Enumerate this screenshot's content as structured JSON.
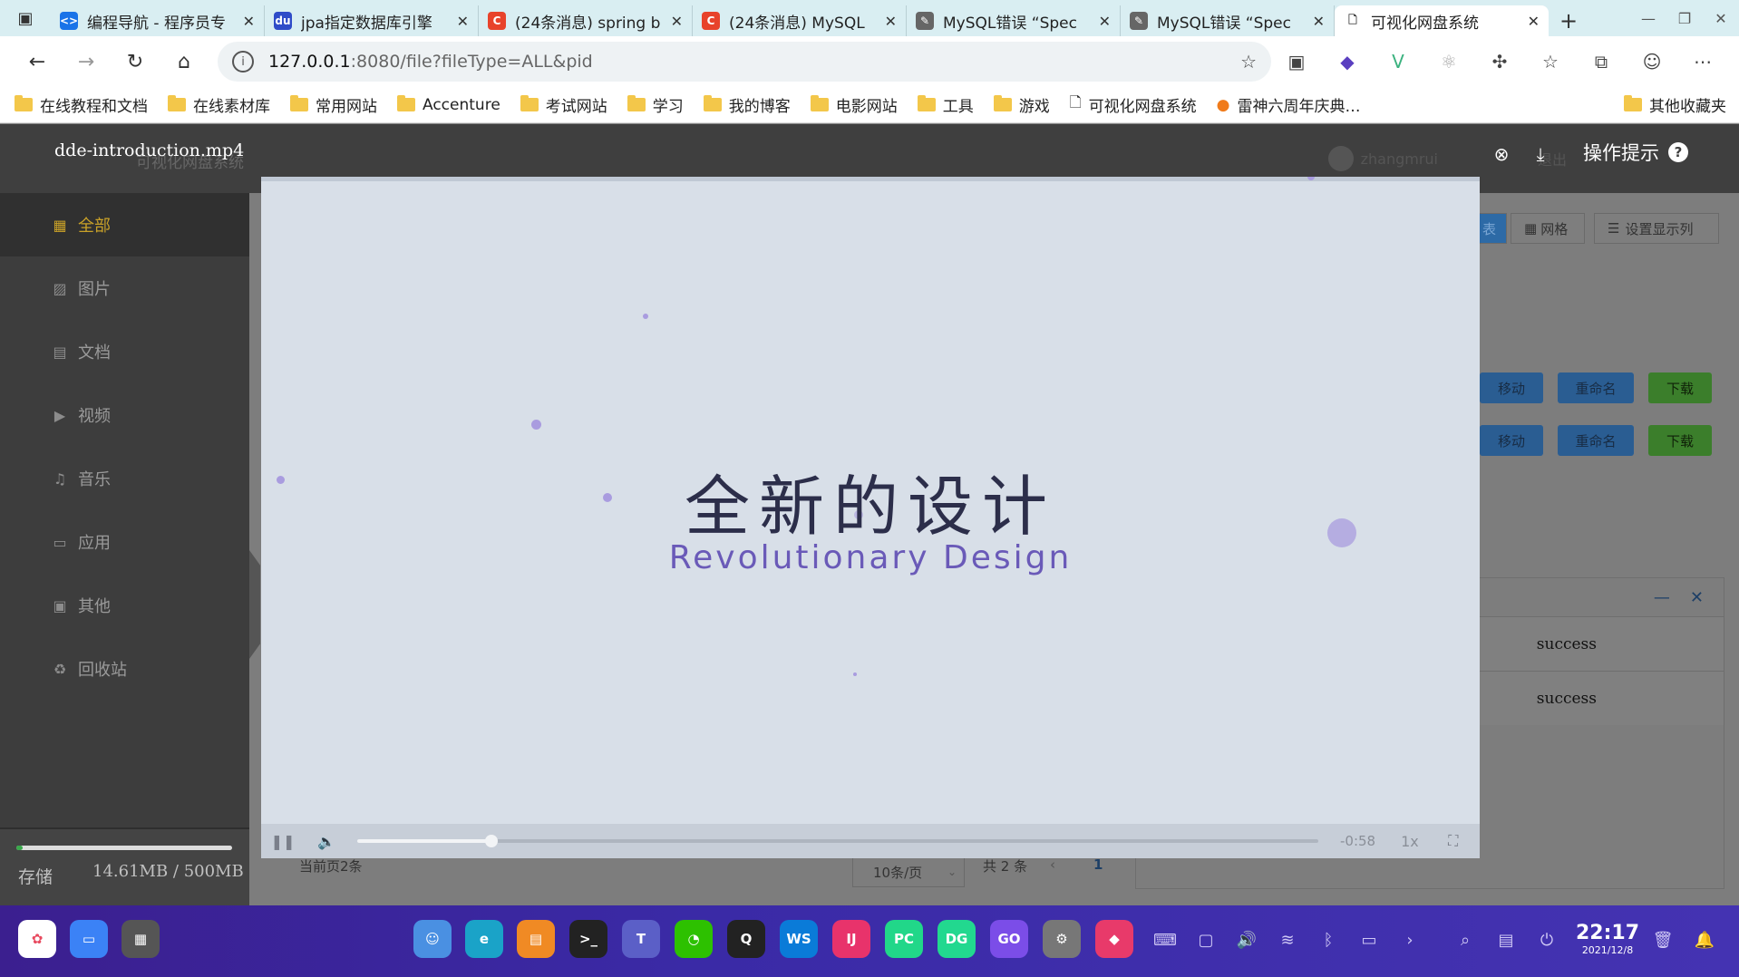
{
  "browser": {
    "tabs": [
      {
        "title": "编程导航 - 程序员专",
        "icon_color": "#1a73e8",
        "icon_text": "<>"
      },
      {
        "title": "jpa指定数据库引擎",
        "icon_color": "#2f4cc8",
        "icon_text": "du"
      },
      {
        "title": "(24条消息) spring b",
        "icon_color": "#e8432b",
        "icon_text": "C"
      },
      {
        "title": "(24条消息) MySQL",
        "icon_color": "#e8432b",
        "icon_text": "C"
      },
      {
        "title": "MySQL错误 “Spec",
        "icon_color": "#666666",
        "icon_text": "✎"
      },
      {
        "title": "MySQL错误 “Spec",
        "icon_color": "#666666",
        "icon_text": "✎"
      },
      {
        "title": "可视化网盘系统",
        "icon_color": "#ffffff",
        "icon_text": "🗋",
        "active": true
      }
    ],
    "url_host": "127.0.0.1",
    "url_rest": ":8080/file?fileType=ALL&pid",
    "bookmarks": [
      "在线教程和文档",
      "在线素材库",
      "常用网站",
      "Accenture",
      "考试网站",
      "学习",
      "我的博客",
      "电影网站",
      "工具",
      "游戏",
      "可视化网盘系统",
      "雷神六周年庆典…"
    ],
    "bookmarks_other": "其他收藏夹"
  },
  "app": {
    "playing_file": "dde-introduction.mp4",
    "system_name": "可视化网盘系统",
    "username": "zhangmrui",
    "logout": "退出",
    "tip_label": "操作提示",
    "sidebar": [
      {
        "label": "全部",
        "icon": "grid-icon",
        "glyph": "▦",
        "active": true
      },
      {
        "label": "图片",
        "icon": "image-icon",
        "glyph": "▨"
      },
      {
        "label": "文档",
        "icon": "document-icon",
        "glyph": "▤"
      },
      {
        "label": "视频",
        "icon": "video-icon",
        "glyph": "▶"
      },
      {
        "label": "音乐",
        "icon": "headphones-icon",
        "glyph": "♫"
      },
      {
        "label": "应用",
        "icon": "monitor-icon",
        "glyph": "▭"
      },
      {
        "label": "其他",
        "icon": "box-icon",
        "glyph": "▣"
      },
      {
        "label": "回收站",
        "icon": "trash-icon",
        "glyph": "♻"
      }
    ],
    "storage": {
      "label": "存储",
      "value": "14.61MB / 500MB",
      "used_fraction": 0.029
    },
    "view_buttons": {
      "list": "表",
      "grid": "网格",
      "columns": "设置显示列"
    },
    "row_actions": {
      "move": "移动",
      "rename": "重命名",
      "download": "下载"
    },
    "notifications": [
      "success",
      "success"
    ],
    "pager": {
      "current": "当前页2条",
      "page_size": "10条/页",
      "total": "共 2 条",
      "page": "1"
    }
  },
  "video": {
    "title_cn": "全新的设计",
    "title_en": "Revolutionary Design",
    "remaining": "-0:58",
    "speed": "1x",
    "progress": 0.14
  },
  "taskbar": {
    "time": "22:17",
    "date": "2021/12/8",
    "apps": [
      {
        "name": "launcher-icon",
        "color": "#ffffff",
        "text": "✿"
      },
      {
        "name": "multitask-icon",
        "color": "#3b82f6",
        "text": "▭"
      },
      {
        "name": "workspace-icon",
        "color": "#555555",
        "text": "▦"
      },
      {
        "name": "finder-icon",
        "color": "#4a90e2",
        "text": "☺"
      },
      {
        "name": "edge-icon",
        "color": "#1aa3c8",
        "text": "e"
      },
      {
        "name": "appstore-icon",
        "color": "#f08a24",
        "text": "▤"
      },
      {
        "name": "terminal-icon",
        "color": "#222222",
        "text": ">_"
      },
      {
        "name": "teams-icon",
        "color": "#5b5fc7",
        "text": "T"
      },
      {
        "name": "wechat-icon",
        "color": "#2dc100",
        "text": "◔"
      },
      {
        "name": "qq-icon",
        "color": "#222222",
        "text": "Q"
      },
      {
        "name": "webstorm-icon",
        "color": "#0a7bd8",
        "text": "WS"
      },
      {
        "name": "intellij-icon",
        "color": "#e8336b",
        "text": "IJ"
      },
      {
        "name": "pycharm-icon",
        "color": "#21d789",
        "text": "PC"
      },
      {
        "name": "datagrip-icon",
        "color": "#22d88f",
        "text": "DG"
      },
      {
        "name": "goland-icon",
        "color": "#7b4de8",
        "text": "GO"
      },
      {
        "name": "settings-icon",
        "color": "#777777",
        "text": "⚙"
      },
      {
        "name": "cube-icon",
        "color": "#e83a6a",
        "text": "◆"
      }
    ]
  }
}
